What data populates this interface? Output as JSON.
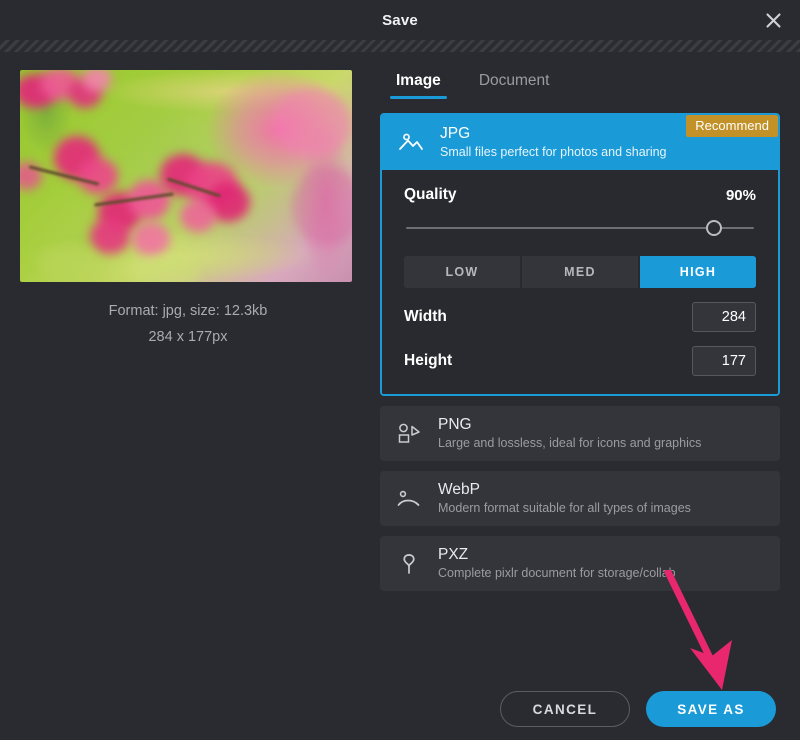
{
  "window": {
    "title": "Save",
    "close_icon": "close-icon"
  },
  "preview": {
    "caption_line1": "Format: jpg, size: 12.3kb",
    "caption_line2": "284 x 177px",
    "image_alt": "blurred pink flowers photo"
  },
  "tabs": [
    {
      "label": "Image",
      "active": true
    },
    {
      "label": "Document",
      "active": false
    }
  ],
  "formats": [
    {
      "name": "JPG",
      "desc": "Small files perfect for photos and sharing",
      "icon": "photo-mountain-icon",
      "badge": "Recommend",
      "selected": true
    },
    {
      "name": "PNG",
      "desc": "Large and lossless, ideal for icons and graphics",
      "icon": "shapes-graphics-icon",
      "selected": false
    },
    {
      "name": "WebP",
      "desc": "Modern format suitable for all types of images",
      "icon": "curve-dot-icon",
      "selected": false
    },
    {
      "name": "PXZ",
      "desc": "Complete pixlr document for storage/collab",
      "icon": "balloon-document-icon",
      "selected": false
    }
  ],
  "jpg_settings": {
    "quality_label": "Quality",
    "quality_value": "90%",
    "quality_percent": 90,
    "segments": [
      {
        "label": "LOW",
        "active": false
      },
      {
        "label": "MED",
        "active": false
      },
      {
        "label": "HIGH",
        "active": true
      }
    ],
    "width_label": "Width",
    "width_value": "284",
    "height_label": "Height",
    "height_value": "177"
  },
  "footer": {
    "cancel_label": "CANCEL",
    "saveas_label": "SAVE AS"
  },
  "annotation": {
    "type": "arrow",
    "points_to": "SAVE AS",
    "color": "#e8276f"
  },
  "colors": {
    "accent_blue": "#1a9bd7",
    "badge_gold": "#c29128",
    "dialog_bg": "#292b30",
    "row_bg": "#33353b",
    "panel_bg": "#282a2f",
    "text_primary": "#ffffff",
    "text_muted": "#9a9ca1",
    "annotation_pink": "#e8276f"
  }
}
